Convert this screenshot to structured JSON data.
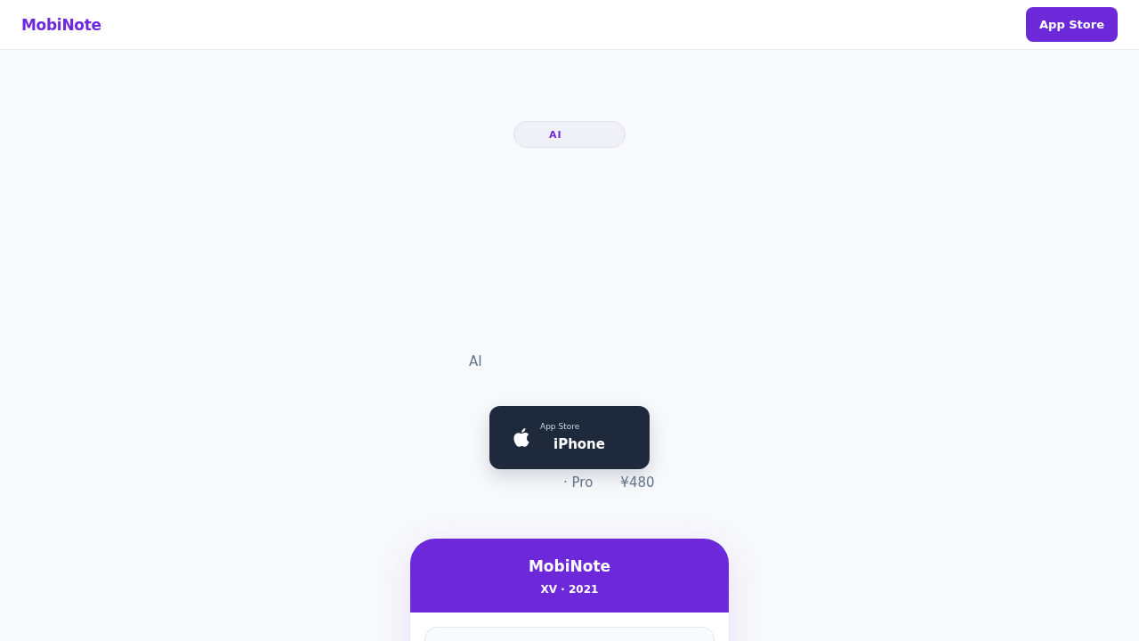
{
  "header": {
    "logo": "MobiNote",
    "cta": "App Store"
  },
  "hero": {
    "badge": "AI",
    "subtitle": "AI",
    "store_button": {
      "caption": "App Store",
      "label": "iPhone"
    },
    "pricing": [
      "· Pro",
      "¥480"
    ]
  },
  "phone": {
    "title": "MobiNote",
    "subtitle": "XV · 2021"
  }
}
